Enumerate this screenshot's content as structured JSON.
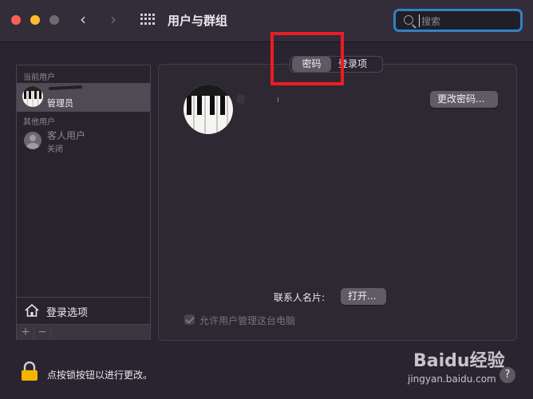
{
  "window": {
    "title": "用户与群组"
  },
  "search": {
    "placeholder": "搜索"
  },
  "users": {
    "current_header": "当前用户",
    "current_user_role": "管理员",
    "others_header": "其他用户",
    "guest_name": "客人用户",
    "guest_status": "关闭",
    "login_options_label": "登录选项",
    "add_label": "+",
    "remove_label": "−"
  },
  "tabs": [
    {
      "label": "密码",
      "selected": true
    },
    {
      "label": "登录项",
      "selected": false
    }
  ],
  "detail": {
    "change_password_button": "更改密码...",
    "contact_card_label": "联系人名片:",
    "open_button": "打开...",
    "allow_admin_label": "允许用户管理这台电脑",
    "allow_admin_checked": true
  },
  "footer": {
    "lock_text": "点按锁按钮以进行更改。",
    "help_label": "?",
    "watermark_brand": "Baidu经验",
    "watermark_url": "jingyan.baidu.com"
  },
  "colors": {
    "highlight": "#ec1c24",
    "search_ring": "#2f83c7",
    "lock": "#f5b400"
  }
}
